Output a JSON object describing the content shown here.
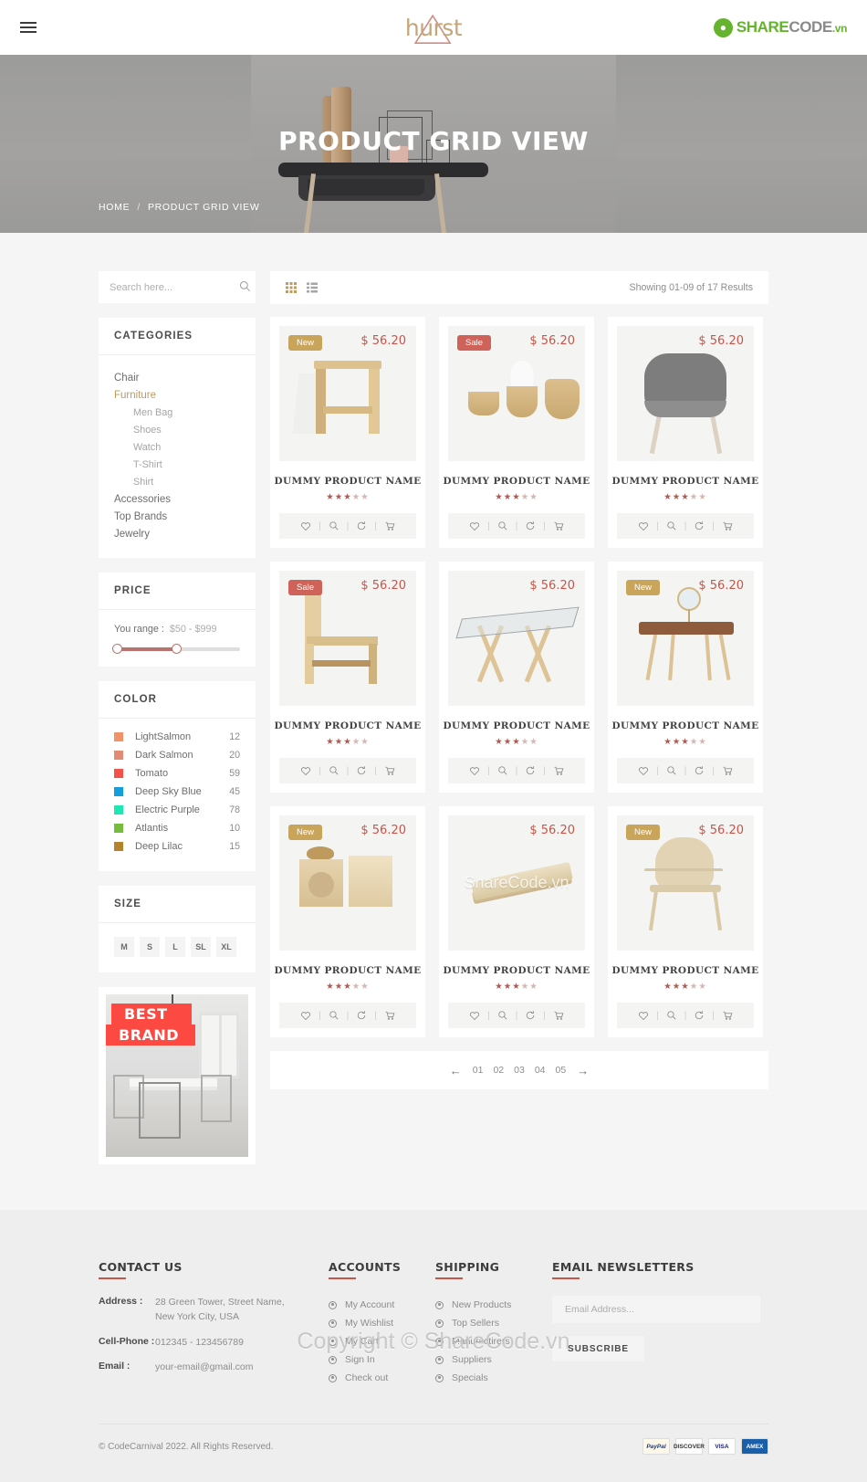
{
  "header": {
    "menu_icon": "hamburger-icon",
    "logo_text": "hurst",
    "watermark_brand": "SHARECODE",
    "watermark_suffix": ".vn"
  },
  "hero": {
    "title": "PRODUCT GRID VIEW",
    "breadcrumb_home": "HOME",
    "breadcrumb_sep": "/",
    "breadcrumb_current": "PRODUCT GRID VIEW"
  },
  "search": {
    "placeholder": "Search here...",
    "icon": "search-icon"
  },
  "categories": {
    "title": "CATEGORIES",
    "items": [
      {
        "label": "Chair",
        "sub": false,
        "active": false
      },
      {
        "label": "Furniture",
        "sub": false,
        "active": true
      },
      {
        "label": "Men Bag",
        "sub": true,
        "active": false
      },
      {
        "label": "Shoes",
        "sub": true,
        "active": false
      },
      {
        "label": "Watch",
        "sub": true,
        "active": false
      },
      {
        "label": "T-Shirt",
        "sub": true,
        "active": false
      },
      {
        "label": "Shirt",
        "sub": true,
        "active": false
      },
      {
        "label": "Accessories",
        "sub": false,
        "active": false
      },
      {
        "label": "Top Brands",
        "sub": false,
        "active": false
      },
      {
        "label": "Jewelry",
        "sub": false,
        "active": false
      }
    ]
  },
  "price": {
    "title": "PRICE",
    "range_label": "You range :",
    "range_value": "$50 - $999",
    "min": 50,
    "max": 999,
    "accent": "#b9736e"
  },
  "color": {
    "title": "COLOR",
    "items": [
      {
        "name": "LightSalmon",
        "count": "12",
        "hex": "#f0936b"
      },
      {
        "name": "Dark Salmon",
        "count": "20",
        "hex": "#e28c74"
      },
      {
        "name": "Tomato",
        "count": "59",
        "hex": "#f4514a"
      },
      {
        "name": "Deep Sky Blue",
        "count": "45",
        "hex": "#139fdd"
      },
      {
        "name": "Electric Purple",
        "count": "78",
        "hex": "#1ce8b5"
      },
      {
        "name": "Atlantis",
        "count": "10",
        "hex": "#76bc3d"
      },
      {
        "name": "Deep Lilac",
        "count": "15",
        "hex": "#b5832e"
      }
    ]
  },
  "size": {
    "title": "SIZE",
    "options": [
      "M",
      "S",
      "L",
      "SL",
      "XL"
    ]
  },
  "promo": {
    "line1": "BEST",
    "line2": "BRAND"
  },
  "toolbar": {
    "grid_icon": "grid-view-icon",
    "list_icon": "list-view-icon",
    "showing": "Showing 01-09 of 17 Results"
  },
  "products": [
    {
      "badge": "New",
      "badge_type": "new",
      "price": "$ 56.20",
      "name": "DUMMY PRODUCT NAME",
      "rating": 3.5,
      "art": "stool"
    },
    {
      "badge": "Sale",
      "badge_type": "sale",
      "price": "$ 56.20",
      "name": "DUMMY PRODUCT NAME",
      "rating": 3.5,
      "art": "bowls"
    },
    {
      "badge": "",
      "badge_type": "",
      "price": "$ 56.20",
      "name": "DUMMY PRODUCT NAME",
      "rating": 3.5,
      "art": "greychair"
    },
    {
      "badge": "Sale",
      "badge_type": "sale",
      "price": "$ 56.20",
      "name": "DUMMY PRODUCT NAME",
      "rating": 3.5,
      "art": "lounge"
    },
    {
      "badge": "",
      "badge_type": "",
      "price": "$ 56.20",
      "name": "DUMMY PRODUCT NAME",
      "rating": 3.5,
      "art": "glasstable"
    },
    {
      "badge": "New",
      "badge_type": "new",
      "price": "$ 56.20",
      "name": "DUMMY PRODUCT NAME",
      "rating": 3.5,
      "art": "vanity"
    },
    {
      "badge": "New",
      "badge_type": "new",
      "price": "$ 56.20",
      "name": "DUMMY PRODUCT NAME",
      "rating": 3.5,
      "art": "blocks"
    },
    {
      "badge": "",
      "badge_type": "",
      "price": "$ 56.20",
      "name": "DUMMY PRODUCT NAME",
      "rating": 3.5,
      "art": "tray"
    },
    {
      "badge": "New",
      "badge_type": "new",
      "price": "$ 56.20",
      "name": "DUMMY PRODUCT NAME",
      "rating": 3.5,
      "art": "armchair"
    }
  ],
  "card_actions": [
    "wishlist-icon",
    "quickview-icon",
    "compare-icon",
    "cart-icon"
  ],
  "pagination": {
    "prev": "←",
    "pages": [
      "01",
      "02",
      "03",
      "04",
      "05"
    ],
    "next": "→"
  },
  "footer": {
    "contact": {
      "title": "CONTACT US",
      "address_label": "Address :",
      "address_value": "28 Green Tower, Street Name,\nNew York City, USA",
      "phone_label": "Cell-Phone :",
      "phone_value": "012345 - 123456789",
      "email_label": "Email :",
      "email_value": "your-email@gmail.com"
    },
    "accounts": {
      "title": "ACCOUNTS",
      "items": [
        "My Account",
        "My Wishlist",
        "My Cart",
        "Sign In",
        "Check out"
      ]
    },
    "shipping": {
      "title": "SHIPPING",
      "items": [
        "New Products",
        "Top Sellers",
        "Manufactirers",
        "Suppliers",
        "Specials"
      ]
    },
    "newsletter": {
      "title": "EMAIL NEWSLETTERS",
      "placeholder": "Email Address...",
      "button": "SUBSCRIBE"
    },
    "copyright": "© CodeCarnival 2022. All Rights Reserved.",
    "payments": [
      "PayPal",
      "DISCOVER",
      "VISA",
      "AMEX"
    ]
  },
  "watermarks": {
    "product_overlay": "ShareCode.vn",
    "footer_overlay": "Copyright © ShareCode.vn"
  }
}
